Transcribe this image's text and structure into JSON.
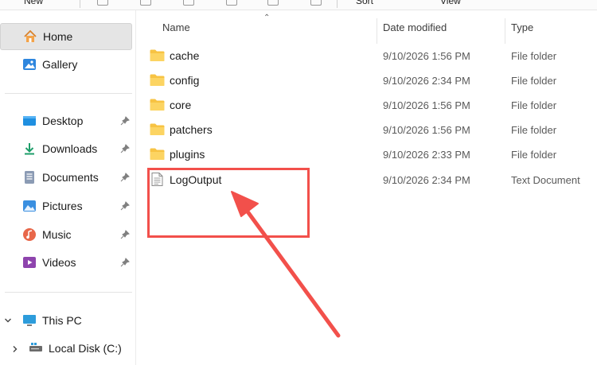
{
  "toolbar": {
    "new_label": "New",
    "sort_label": "Sort",
    "view_label": "View"
  },
  "sidebar": {
    "quick": [
      {
        "label": "Home",
        "icon": "home-icon",
        "selected": true
      },
      {
        "label": "Gallery",
        "icon": "gallery-icon"
      }
    ],
    "pinned": [
      {
        "label": "Desktop",
        "icon": "desktop-icon"
      },
      {
        "label": "Downloads",
        "icon": "downloads-icon"
      },
      {
        "label": "Documents",
        "icon": "documents-icon"
      },
      {
        "label": "Pictures",
        "icon": "pictures-icon"
      },
      {
        "label": "Music",
        "icon": "music-icon"
      },
      {
        "label": "Videos",
        "icon": "videos-icon"
      }
    ],
    "this_pc": {
      "label": "This PC",
      "icon": "computer-icon"
    },
    "local_disk": {
      "label": "Local Disk (C:)",
      "icon": "drive-icon"
    }
  },
  "columns": {
    "name": "Name",
    "date": "Date modified",
    "type": "Type"
  },
  "files": [
    {
      "name": "cache",
      "date": "9/10/2026 1:56 PM",
      "type": "File folder",
      "kind": "folder"
    },
    {
      "name": "config",
      "date": "9/10/2026 2:34 PM",
      "type": "File folder",
      "kind": "folder"
    },
    {
      "name": "core",
      "date": "9/10/2026 1:56 PM",
      "type": "File folder",
      "kind": "folder"
    },
    {
      "name": "patchers",
      "date": "9/10/2026 1:56 PM",
      "type": "File folder",
      "kind": "folder"
    },
    {
      "name": "plugins",
      "date": "9/10/2026 2:33 PM",
      "type": "File folder",
      "kind": "folder"
    },
    {
      "name": "LogOutput",
      "date": "9/10/2026 2:34 PM",
      "type": "Text Document",
      "kind": "text"
    }
  ],
  "colors": {
    "annotation": "#f2504b",
    "folder": "#f7c343",
    "selection": "#e5e5e5"
  }
}
